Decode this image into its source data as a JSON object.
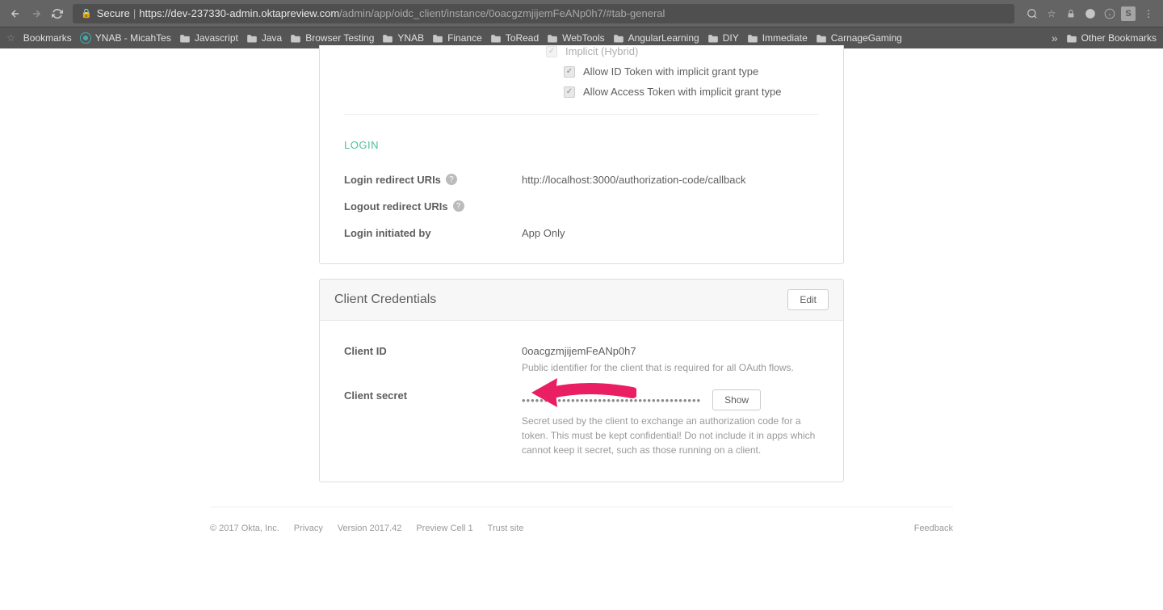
{
  "browser": {
    "secure_label": "Secure",
    "url_host": "https://dev-237330-admin.oktapreview.com",
    "url_path": "/admin/app/oidc_client/instance/0oacgzmjijemFeANp0h7/#tab-general"
  },
  "bookmarks": {
    "label": "Bookmarks",
    "items": [
      "YNAB - MicahTes",
      "Javascript",
      "Java",
      "Browser Testing",
      "YNAB",
      "Finance",
      "ToRead",
      "WebTools",
      "AngularLearning",
      "DIY",
      "Immediate",
      "CarnageGaming"
    ],
    "other": "Other Bookmarks"
  },
  "grants": {
    "implicit_label": "Implicit (Hybrid)",
    "id_token_label": "Allow ID Token with implicit grant type",
    "access_token_label": "Allow Access Token with implicit grant type"
  },
  "login": {
    "heading": "LOGIN",
    "redirect_label": "Login redirect URIs",
    "redirect_value": "http://localhost:3000/authorization-code/callback",
    "logout_label": "Logout redirect URIs",
    "initiated_label": "Login initiated by",
    "initiated_value": "App Only"
  },
  "credentials": {
    "heading": "Client Credentials",
    "edit_label": "Edit",
    "client_id_label": "Client ID",
    "client_id_value": "0oacgzmjijemFeANp0h7",
    "client_id_desc": "Public identifier for the client that is required for all OAuth flows.",
    "client_secret_label": "Client secret",
    "client_secret_masked": "••••••••••••••••••••••••••••••••••••••••",
    "show_label": "Show",
    "client_secret_desc": "Secret used by the client to exchange an authorization code for a token. This must be kept confidential! Do not include it in apps which cannot keep it secret, such as those running on a client."
  },
  "footer": {
    "copyright": "© 2017 Okta, Inc.",
    "privacy": "Privacy",
    "version": "Version 2017.42",
    "preview": "Preview Cell 1",
    "trust": "Trust site",
    "feedback": "Feedback"
  }
}
